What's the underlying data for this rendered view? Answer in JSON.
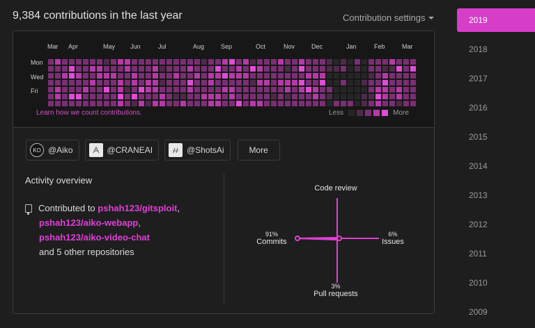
{
  "header": {
    "title": "9,384 contributions in the last year",
    "settings_label": "Contribution settings"
  },
  "calendar": {
    "months": [
      "Mar",
      "Apr",
      "May",
      "Jun",
      "Jul",
      "Aug",
      "Sep",
      "Oct",
      "Nov",
      "Dec",
      "Jan",
      "Feb",
      "Mar"
    ],
    "days": [
      "Mon",
      "Wed",
      "Fri"
    ],
    "learn_link": "Learn how we count contributions.",
    "legend_less": "Less",
    "legend_more": "More",
    "colors": [
      "#262626",
      "#4e2a4a",
      "#7a2f74",
      "#b53aa8",
      "#e04cd6"
    ]
  },
  "orgs": {
    "items": [
      {
        "label": "@Aiko",
        "icon": "KO"
      },
      {
        "label": "@CRANEAI",
        "icon": "crane-logo-icon"
      },
      {
        "label": "@ShotsAi",
        "icon": "shots-logo-icon"
      }
    ],
    "more_label": "More"
  },
  "activity": {
    "title": "Activity overview",
    "contributed_to": "Contributed to",
    "repos": [
      "pshah123/gitsploit",
      "pshah123/aiko-webapp",
      "pshah123/aiko-video-chat"
    ],
    "comma": ",",
    "others": "and 5 other repositories"
  },
  "overview_chart": {
    "code_review": {
      "label": "Code review",
      "pct": ""
    },
    "commits": {
      "label": "Commits",
      "pct": "91%"
    },
    "issues": {
      "label": "Issues",
      "pct": "6%"
    },
    "pull_requests": {
      "label": "Pull requests",
      "pct": "3%"
    },
    "accent": "#e040d6"
  },
  "sidebar": {
    "years": [
      "2019",
      "2018",
      "2017",
      "2016",
      "2015",
      "2014",
      "2013",
      "2012",
      "2011",
      "2010",
      "2009"
    ]
  }
}
